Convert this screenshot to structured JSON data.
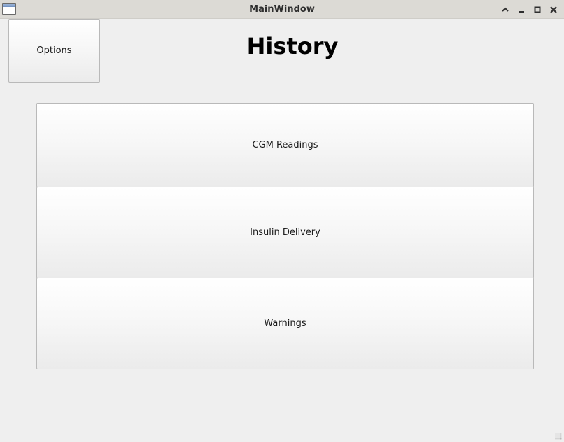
{
  "window": {
    "title": "MainWindow"
  },
  "titlebar_controls": [
    "chevron-up-icon",
    "minimize-icon",
    "maximize-icon",
    "close-icon"
  ],
  "main": {
    "options_label": "Options",
    "heading": "History",
    "buttons": [
      {
        "label": "CGM Readings"
      },
      {
        "label": "Insulin Delivery"
      },
      {
        "label": "Warnings"
      }
    ]
  },
  "colors": {
    "titlebar_bg": "#dcdad5",
    "window_bg": "#efefef",
    "button_border": "#b9b9b9"
  }
}
